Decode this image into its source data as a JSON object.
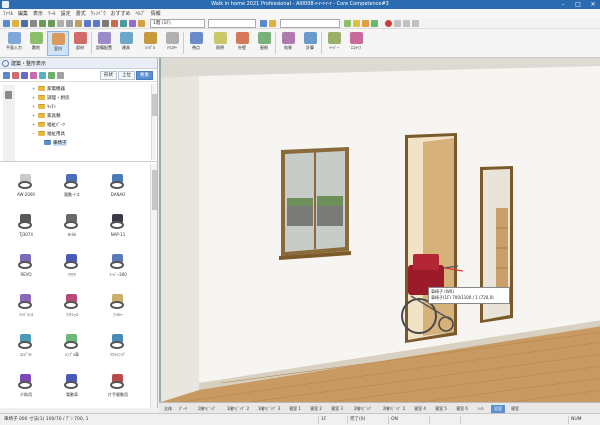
{
  "window": {
    "title": "Walk in home 2021 Professional - AI0008-r-r-r-r-r - Core Competence#3",
    "min": "–",
    "max": "□",
    "close": "✕"
  },
  "menu": [
    "ﾌｧｲﾙ",
    "編集",
    "表示",
    "ﾂｰﾙ",
    "設定",
    "書式",
    "ｳｨﾝﾄﾞｳ",
    "おすすめ",
    "ﾍﾙﾌﾟ",
    "情報"
  ],
  "quickbar": {
    "floor_combo": "1階 (1F)",
    "scale_combo": "",
    "size_combo": ""
  },
  "ribbon": [
    {
      "label": "平面入力",
      "color": "#7fa7d9"
    },
    {
      "label": "敷地",
      "color": "#8bbf6a"
    },
    {
      "label": "室内",
      "color": "#d99a5b"
    },
    {
      "label": "部材",
      "color": "#d46b6b"
    },
    {
      "label": "設備配置",
      "color": "#9b8bc9"
    },
    {
      "label": "建具",
      "color": "#6aa7c9"
    },
    {
      "label": "ｼﾝﾎﾞﾙ",
      "color": "#c99a3c"
    },
    {
      "label": "ﾃｸｽﾁｬ",
      "color": "#b0b0b0"
    },
    {
      "label": "視点",
      "color": "#6a8bc9"
    },
    {
      "label": "照明",
      "color": "#c9c96a"
    },
    {
      "label": "外壁",
      "color": "#d47a5a"
    },
    {
      "label": "屋根",
      "color": "#7ab07a"
    },
    {
      "label": "効果",
      "color": "#b07ab0"
    },
    {
      "label": "計算",
      "color": "#6a9ac9"
    },
    {
      "label": "ｲｰｼﾞｰ",
      "color": "#9ab06a"
    },
    {
      "label": "ｴｺﾗｲﾌ",
      "color": "#c96a9a"
    }
  ],
  "panel": {
    "title": "建築・整形表示",
    "tabs": [
      "形状",
      "上位",
      "要素"
    ],
    "tree": [
      {
        "label": "家電機器",
        "level": 2
      },
      {
        "label": "調理・厨房",
        "level": 2
      },
      {
        "label": "ｷｯﾁﾝ",
        "level": 2
      },
      {
        "label": "家具類",
        "level": 2
      },
      {
        "label": "福祉ﾊﾟｰﾂ",
        "level": 2
      },
      {
        "label": "福祉用具",
        "level": 2
      },
      {
        "label": "車椅子",
        "level": 3
      }
    ],
    "items": [
      "AW-2000",
      "電動イス",
      "DANAO",
      "TJ3074",
      "mini",
      "NAP-11",
      "REVO",
      "ｱｸｱｸ",
      "ｲｰｼﾞｰ300",
      "ｲﾝﾊﾞﾗﾝｽ",
      "ｿﾌﾄｼｪﾙ",
      "ﾌｨﾙｼｰ",
      "ｺﾝﾊﾟｸﾄ",
      "ｼﾝﾌﾟﾙ車",
      "ﾘｸﾗｲﾆﾝｸﾞ",
      "介助用",
      "電動車",
      "片手駆動用"
    ],
    "item_colors": [
      "#c9c9c9",
      "#4a6fb8",
      "#4a7ab8",
      "#5a5a5a",
      "#6a6a6a",
      "#3a3a4a",
      "#7a6ab8",
      "#4a5ab8",
      "#5a7ab8",
      "#8a6ab8",
      "#b84a7a",
      "#c9b06a",
      "#4a9ab8",
      "#6ab87a",
      "#4a8ab8",
      "#7a4ab8",
      "#4a5ab8",
      "#b84a4a"
    ]
  },
  "view": {
    "tooltip_line1": "車椅子 (W0)",
    "tooltip_line2": "車椅子(1F) 700/1100 / 1 (720,0) "
  },
  "floortabs": [
    "全体",
    "ﾎﾟｰﾁ",
    "1階ﾘﾋﾞﾝｸﾞ",
    "1階ﾘﾋﾞﾝｸﾞ 2",
    "1階ﾘﾋﾞﾝｸﾞ 3",
    "寝室 1",
    "寝室 2",
    "寝室 3",
    "2階ﾘﾋﾞﾝｸﾞ",
    "2階ﾘﾋﾞﾝｸﾞ 2",
    "寝室 4",
    "寝室 5",
    "寝室 6",
    "ﾄｲﾚ",
    "浴室",
    "寝室"
  ],
  "status": {
    "left": "車椅子 000 寸法(1) 100/70 / ﾃﾞﾝ 700, 1",
    "c2": "1F",
    "c3": "完了(0)",
    "c4": "ON",
    "c5": "",
    "c6": "",
    "right": "NUM"
  }
}
